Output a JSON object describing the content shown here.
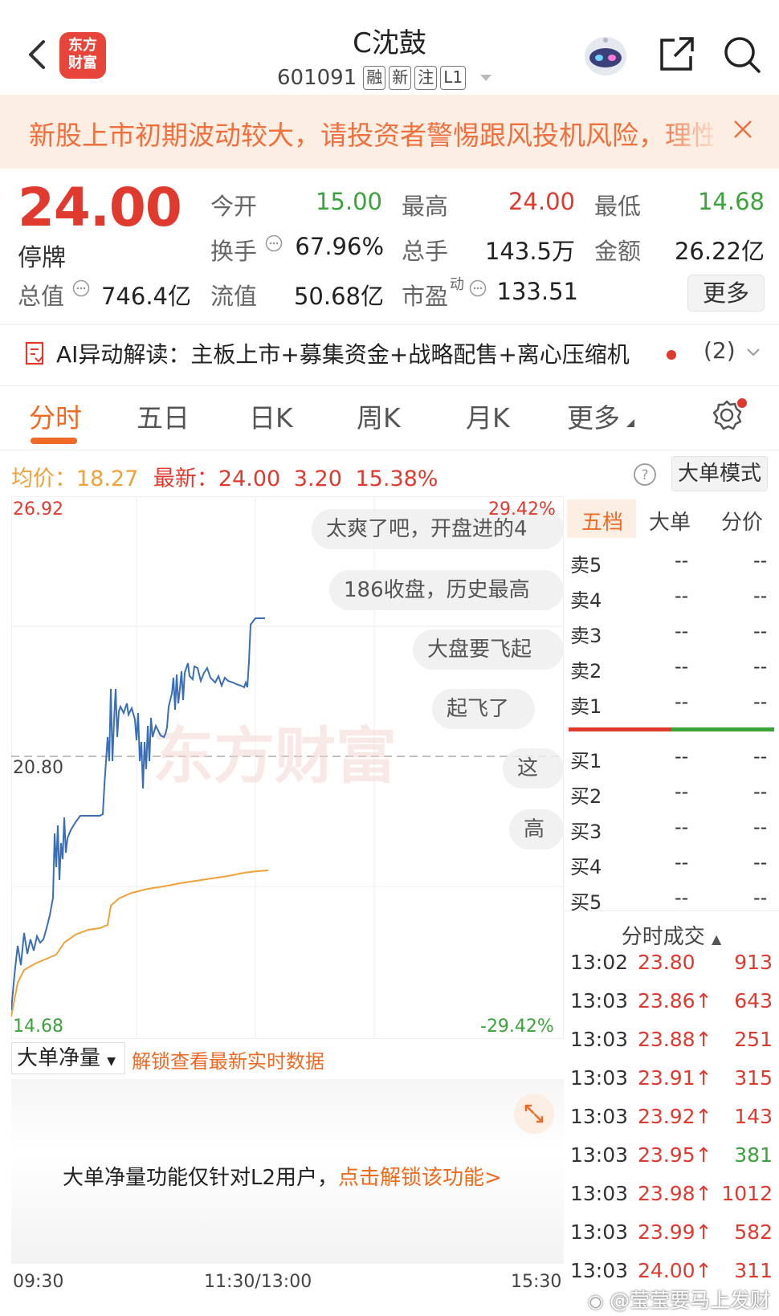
{
  "header": {
    "logo_text_1": "东方",
    "logo_text_2": "财富",
    "stock_name": "C沈鼓",
    "stock_code": "601091",
    "tags": [
      "融",
      "新",
      "注",
      "L1"
    ]
  },
  "banner": {
    "text": "新股上市初期波动较大，请投资者警惕跟风投机风险，理性"
  },
  "quote": {
    "price": "24.00",
    "status": "停牌",
    "open_label": "今开",
    "open": "15.00",
    "high_label": "最高",
    "high": "24.00",
    "low_label": "最低",
    "low": "14.68",
    "turnover_label": "换手",
    "turnover": "67.96%",
    "volume_label": "总手",
    "volume": "143.5万",
    "amount_label": "金额",
    "amount": "26.22亿",
    "mcap_label": "总值",
    "mcap": "746.4亿",
    "float_label": "流值",
    "float_mcap": "50.68亿",
    "pe_label": "市盈",
    "pe_sup": "动",
    "pe": "133.51",
    "more_label": "更多"
  },
  "ai": {
    "label": "AI异动解读：主板上市+募集资金+战略配售+离心压缩机",
    "count": "(2)"
  },
  "tabs": [
    "分时",
    "五日",
    "日K",
    "周K",
    "月K",
    "更多"
  ],
  "infobar": {
    "avg_label": "均价：",
    "avg": "18.27",
    "latest_label": "最新：",
    "latest": "24.00",
    "change": "3.20",
    "change_pct": "15.38%",
    "bigorder_mode": "大单模式"
  },
  "chart_labels": {
    "top_price": "26.92",
    "top_pct": "29.42%",
    "mid_price": "20.80",
    "bottom_price": "14.68",
    "bottom_pct": "-29.42%",
    "watermark": "东方财富"
  },
  "comments": [
    "太爽了吧，开盘进的4",
    "186收盘，历史最高",
    "大盘要飞起",
    "起飞了",
    "这",
    "高"
  ],
  "orderbook": {
    "tabs": [
      "五档",
      "大单",
      "分价"
    ],
    "asks": [
      {
        "label": "卖5",
        "price": "--",
        "vol": "--"
      },
      {
        "label": "卖4",
        "price": "--",
        "vol": "--"
      },
      {
        "label": "卖3",
        "price": "--",
        "vol": "--"
      },
      {
        "label": "卖2",
        "price": "--",
        "vol": "--"
      },
      {
        "label": "卖1",
        "price": "--",
        "vol": "--"
      }
    ],
    "bids": [
      {
        "label": "买1",
        "price": "--",
        "vol": "--"
      },
      {
        "label": "买2",
        "price": "--",
        "vol": "--"
      },
      {
        "label": "买3",
        "price": "--",
        "vol": "--"
      },
      {
        "label": "买4",
        "price": "--",
        "vol": "--"
      },
      {
        "label": "买5",
        "price": "--",
        "vol": "--"
      }
    ],
    "ticks_title": "分时成交",
    "ticks": [
      {
        "time": "13:02",
        "price": "23.80",
        "vol": "913",
        "dir": "",
        "side": "sell"
      },
      {
        "time": "13:03",
        "price": "23.86↑",
        "vol": "643",
        "dir": "",
        "side": "sell"
      },
      {
        "time": "13:03",
        "price": "23.88↑",
        "vol": "251",
        "dir": "",
        "side": "sell"
      },
      {
        "time": "13:03",
        "price": "23.91↑",
        "vol": "315",
        "dir": "",
        "side": "sell"
      },
      {
        "time": "13:03",
        "price": "23.92↑",
        "vol": "143",
        "dir": "",
        "side": "sell"
      },
      {
        "time": "13:03",
        "price": "23.95↑",
        "vol": "381",
        "dir": "",
        "side": "buy"
      },
      {
        "time": "13:03",
        "price": "23.98↑",
        "vol": "1012",
        "dir": "",
        "side": "sell"
      },
      {
        "time": "13:03",
        "price": "23.99↑",
        "vol": "582",
        "dir": "",
        "side": "sell"
      },
      {
        "time": "13:03",
        "price": "24.00↑",
        "vol": "311",
        "dir": "",
        "side": "sell"
      }
    ]
  },
  "net_volume": {
    "select_label": "大单净量",
    "unlock_link": "解锁查看最新实时数据",
    "message": "大单净量功能仅针对L2用户，",
    "message_link": "点击解锁该功能>"
  },
  "time_axis": [
    "09:30",
    "11:30/13:00",
    "15:30"
  ],
  "watermark": "@莹莹要马上发财",
  "colors": {
    "up": "#e03a2f",
    "down": "#3aa33a",
    "accent": "#ef6a24",
    "price_line": "#3a6fb7",
    "avg_line": "#f0a23a"
  }
}
